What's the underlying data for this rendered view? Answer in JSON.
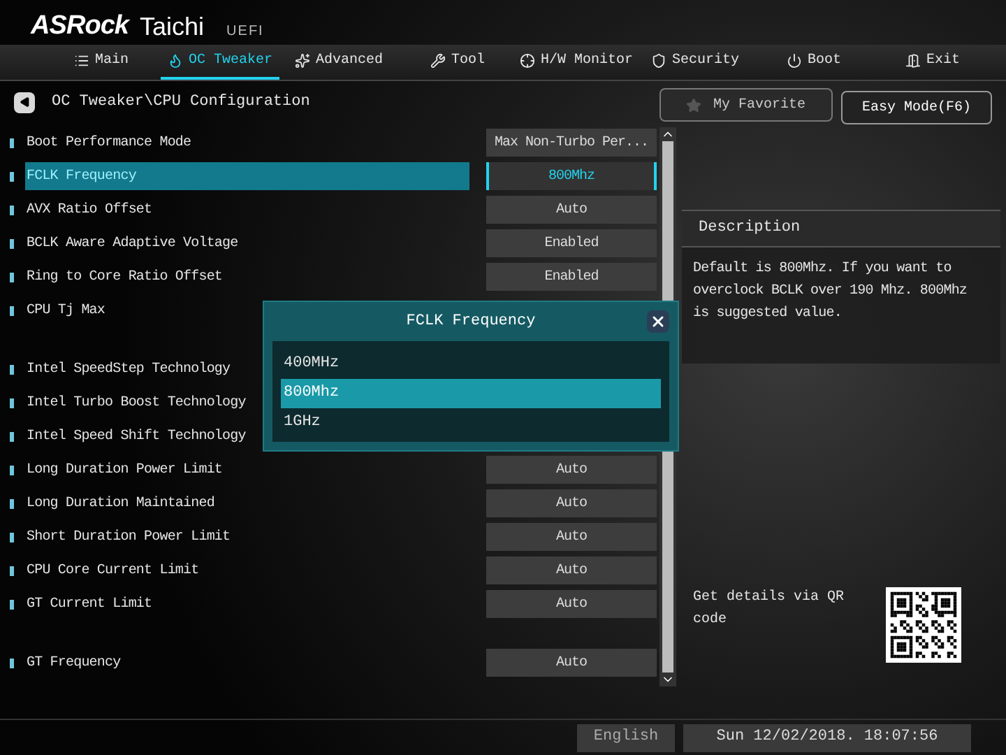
{
  "header": {
    "brand": "ASRock",
    "model": "Taichi",
    "firmware": "UEFI"
  },
  "tabs": [
    {
      "label": "Main",
      "selected": false
    },
    {
      "label": "OC Tweaker",
      "selected": true
    },
    {
      "label": "Advanced",
      "selected": false
    },
    {
      "label": "Tool",
      "selected": false
    },
    {
      "label": "H/W Monitor",
      "selected": false
    },
    {
      "label": "Security",
      "selected": false
    },
    {
      "label": "Boot",
      "selected": false
    },
    {
      "label": "Exit",
      "selected": false
    }
  ],
  "breadcrumb": "OC Tweaker\\CPU Configuration",
  "favorite_button": "My Favorite",
  "easy_mode_button": "Easy Mode(F6)",
  "setting_groups": [
    {
      "settings": [
        {
          "label": "Boot Performance Mode",
          "value": "Max Non-Turbo Per...",
          "selected": false
        },
        {
          "label": "FCLK Frequency",
          "value": "800Mhz",
          "selected": true
        },
        {
          "label": "AVX Ratio Offset",
          "value": "Auto",
          "selected": false
        },
        {
          "label": "BCLK Aware Adaptive Voltage",
          "value": "Enabled",
          "selected": false
        },
        {
          "label": "Ring to Core Ratio Offset",
          "value": "Enabled",
          "selected": false
        },
        {
          "label": "CPU Tj Max",
          "selected": false
        }
      ]
    },
    {
      "settings": [
        {
          "label": "Intel SpeedStep Technology",
          "selected": false
        },
        {
          "label": "Intel Turbo Boost Technology",
          "selected": false
        },
        {
          "label": "Intel Speed Shift Technology",
          "selected": false
        },
        {
          "label": "Long Duration Power Limit",
          "value": "Auto",
          "selected": false
        },
        {
          "label": "Long Duration Maintained",
          "value": "Auto",
          "selected": false
        },
        {
          "label": "Short Duration Power Limit",
          "value": "Auto",
          "selected": false
        },
        {
          "label": "CPU Core Current Limit",
          "value": "Auto",
          "selected": false
        },
        {
          "label": "GT Current Limit",
          "value": "Auto",
          "selected": false
        }
      ]
    },
    {
      "settings": [
        {
          "label": "GT Frequency",
          "value": "Auto",
          "selected": false
        }
      ]
    }
  ],
  "description": {
    "title": "Description",
    "text": "Default is 800Mhz. If you want to overclock BCLK over 190 Mhz. 800Mhz is suggested value."
  },
  "qr_hint": "Get details via QR code",
  "dialog": {
    "title": "FCLK Frequency",
    "options": [
      {
        "label": "400MHz",
        "selected": false
      },
      {
        "label": "800Mhz",
        "selected": true
      },
      {
        "label": "1GHz",
        "selected": false
      }
    ]
  },
  "footer": {
    "language": "English",
    "datetime": "Sun 12/02/2018. 18:07:56"
  }
}
